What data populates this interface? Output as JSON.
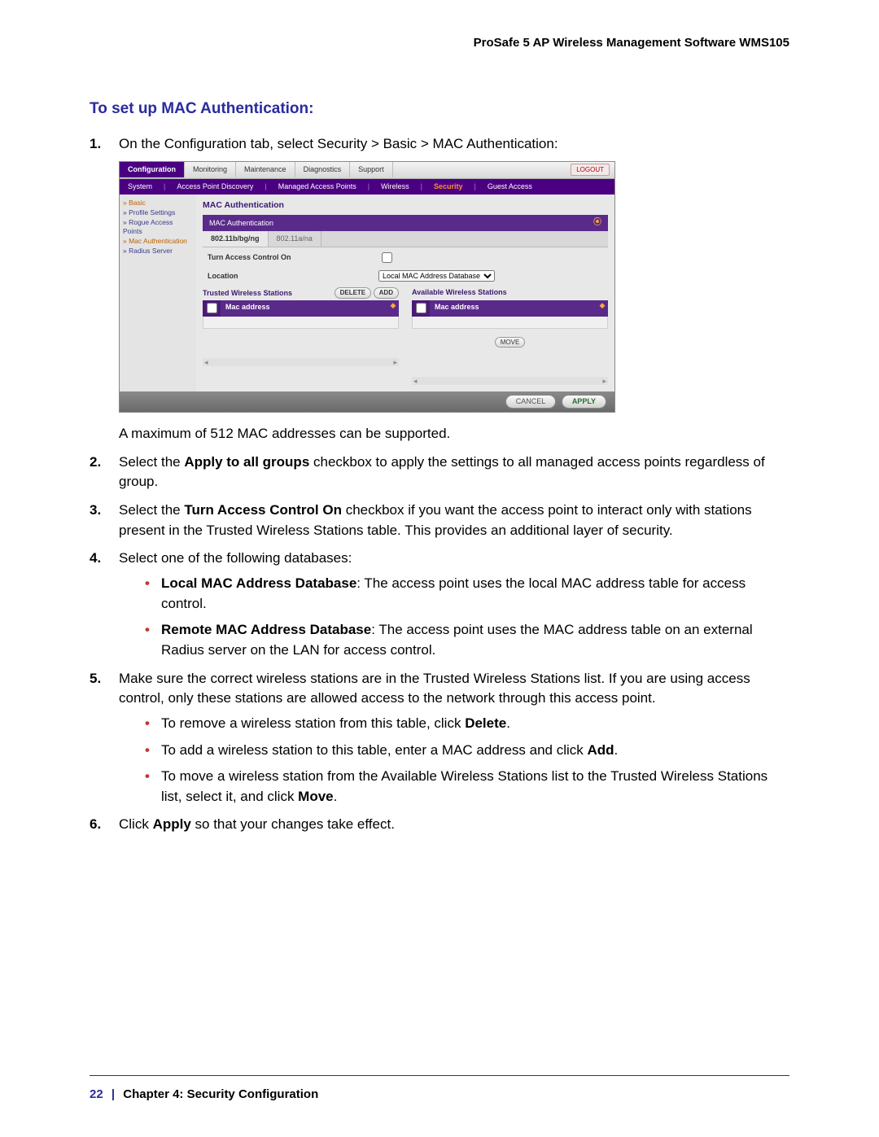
{
  "doc": {
    "header": "ProSafe 5 AP Wireless Management Software WMS105",
    "section_title": "To set up MAC Authentication:",
    "footer_page": "22",
    "footer_chapter": "Chapter 4:  Security Configuration"
  },
  "steps": {
    "s1": "On the Configuration tab, select Security > Basic > MAC Authentication:",
    "s1_after": "A maximum of 512 MAC addresses can be supported.",
    "s2_a": "Select the ",
    "s2_b": "Apply to all groups",
    "s2_c": " checkbox to apply the settings to all managed access points regardless of group.",
    "s3_a": "Select the ",
    "s3_b": "Turn Access Control On",
    "s3_c": " checkbox if you want the access point to interact only with stations present in the Trusted Wireless Stations table. This provides an additional layer of security.",
    "s4": "Select one of the following databases:",
    "s4_b1_a": "Local MAC Address Database",
    "s4_b1_b": ": The access point uses the local MAC address table for access control.",
    "s4_b2_a": "Remote MAC Address Database",
    "s4_b2_b": ": The access point uses the MAC address table on an external Radius server on the LAN for access control.",
    "s5": "Make sure the correct wireless stations are in the Trusted Wireless Stations list. If you are using access control, only these stations are allowed access to the network through this access point.",
    "s5_b1_a": "To remove a wireless station from this table, click ",
    "s5_b1_b": "Delete",
    "s5_b1_c": ".",
    "s5_b2_a": "To add a wireless station to this table, enter a MAC address and click ",
    "s5_b2_b": "Add",
    "s5_b2_c": ".",
    "s5_b3_a": "To move a wireless station from the Available Wireless Stations list to the Trusted Wireless Stations list, select it, and click ",
    "s5_b3_b": "Move",
    "s5_b3_c": ".",
    "s6_a": "Click ",
    "s6_b": "Apply",
    "s6_c": " so that your changes take effect."
  },
  "shot": {
    "tabs": {
      "configuration": "Configuration",
      "monitoring": "Monitoring",
      "maintenance": "Maintenance",
      "diagnostics": "Diagnostics",
      "support": "Support"
    },
    "logout": "LOGOUT",
    "subnav": {
      "system": "System",
      "apd": "Access Point Discovery",
      "map": "Managed Access Points",
      "wireless": "Wireless",
      "security": "Security",
      "guest": "Guest Access"
    },
    "side": {
      "basic": "» Basic",
      "profile": "» Profile Settings",
      "rogue": "» Rogue Access Points",
      "macauth": "» Mac Authentication",
      "radius": "» Radius Server"
    },
    "panel_title": "MAC Authentication",
    "band_title": "MAC Authentication",
    "radio": {
      "bg": "802.11b/bg/ng",
      "a": "802.11a/na"
    },
    "kv_turn": "Turn Access Control On",
    "kv_loc": "Location",
    "kv_loc_opt": "Local MAC Address Database",
    "trusted": "Trusted Wireless Stations",
    "avail": "Available Wireless Stations",
    "machead": "Mac address",
    "btn": {
      "delete": "DELETE",
      "add": "ADD",
      "move": "MOVE",
      "cancel": "CANCEL",
      "apply": "APPLY"
    }
  }
}
